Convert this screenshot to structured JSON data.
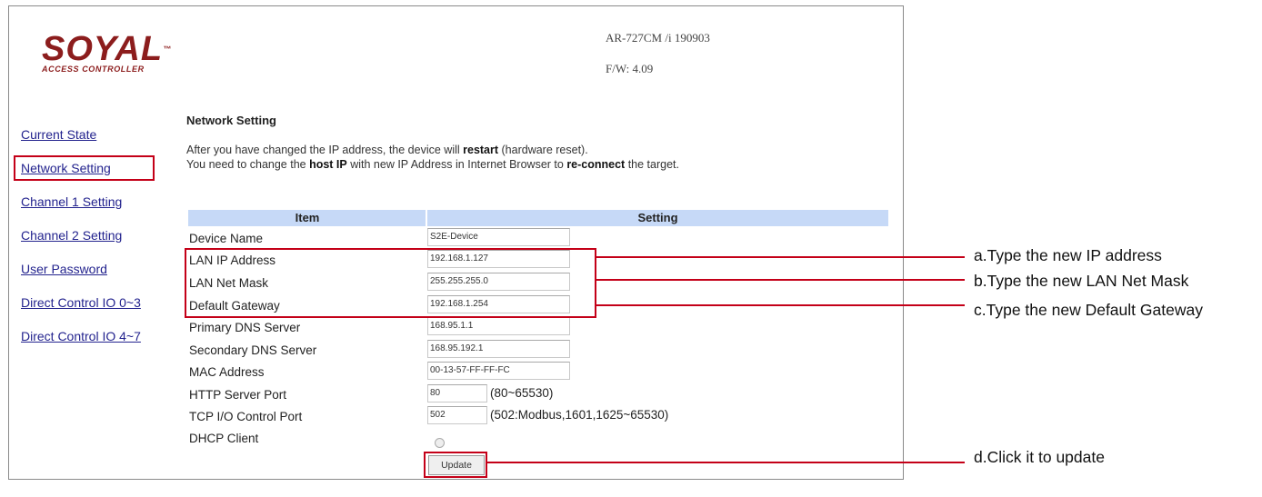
{
  "brand": {
    "logo_text": "SOYAL",
    "logo_tm": "™",
    "logo_subtitle": "ACCESS CONTROLLER"
  },
  "device": {
    "model": "AR-727CM /i 190903",
    "firmware": "F/W: 4.09"
  },
  "nav": {
    "items": [
      {
        "label": "Current State"
      },
      {
        "label": "Network Setting"
      },
      {
        "label": "Channel 1 Setting"
      },
      {
        "label": "Channel 2 Setting"
      },
      {
        "label": "User Password"
      },
      {
        "label": "Direct Control IO 0~3"
      },
      {
        "label": "Direct Control IO 4~7"
      }
    ]
  },
  "main": {
    "title": "Network Setting",
    "notice": {
      "line1_a": "After you have changed the IP address, the device will ",
      "line1_b": "restart",
      "line1_c": " (hardware reset).",
      "line2_a": "You need to change the ",
      "line2_b": "host IP",
      "line2_c": " with new IP Address in Internet Browser to ",
      "line2_d": "re-connect",
      "line2_e": " the target."
    },
    "table": {
      "col_item": "Item",
      "col_setting": "Setting",
      "rows": [
        {
          "label": "Device Name",
          "value": "S2E-Device"
        },
        {
          "label": "LAN IP Address",
          "value": "192.168.1.127"
        },
        {
          "label": "LAN Net Mask",
          "value": "255.255.255.0"
        },
        {
          "label": "Default Gateway",
          "value": "192.168.1.254"
        },
        {
          "label": "Primary DNS Server",
          "value": "168.95.1.1"
        },
        {
          "label": "Secondary DNS Server",
          "value": "168.95.192.1"
        },
        {
          "label": "MAC Address",
          "value": "00-13-57-FF-FF-FC"
        },
        {
          "label": "HTTP Server Port",
          "value": "80",
          "hint": "(80~65530)"
        },
        {
          "label": "TCP I/O Control Port",
          "value": "502",
          "hint": "(502:Modbus,1601,1625~65530)"
        },
        {
          "label": "DHCP Client"
        }
      ]
    },
    "update_label": "Update"
  },
  "annotations": {
    "a": "a.Type the new IP address",
    "b": "b.Type the new LAN Net Mask",
    "c": "c.Type the new Default Gateway",
    "d": "d.Click it to update"
  },
  "colors": {
    "highlight": "#c40018",
    "table_header": "#c6d9f7",
    "link": "#23238e",
    "logo": "#8c1d1d"
  }
}
